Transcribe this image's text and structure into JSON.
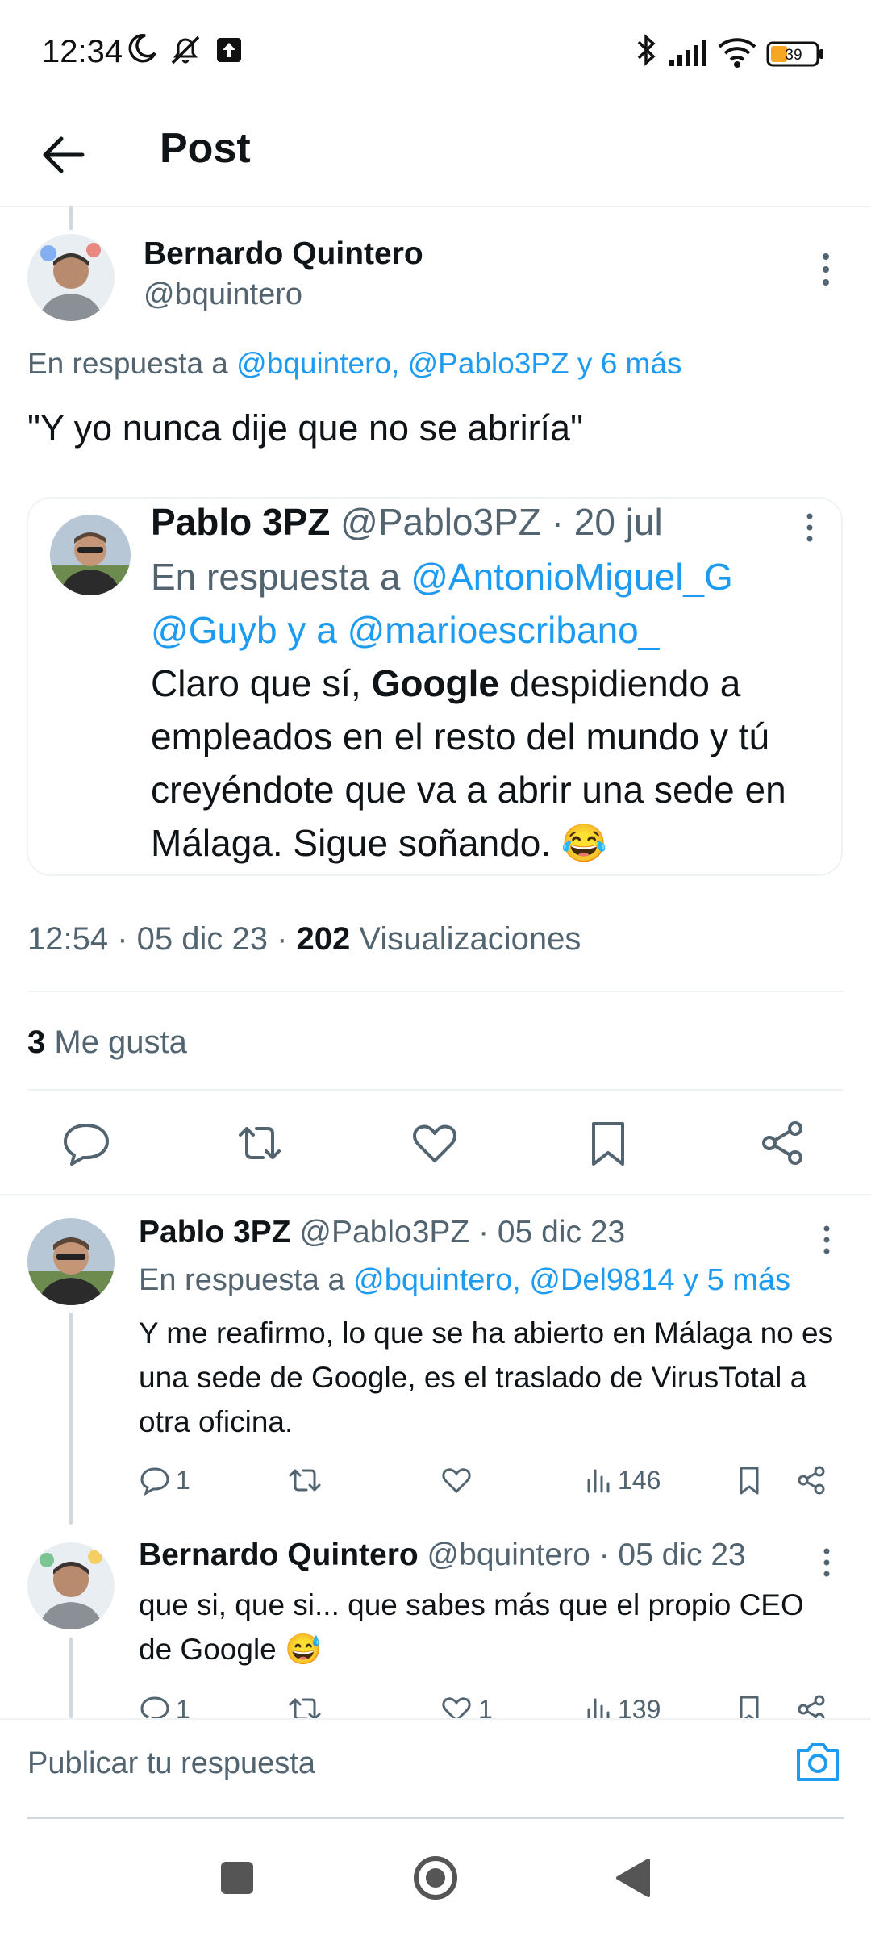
{
  "status_bar": {
    "time": "12:34",
    "battery": "39"
  },
  "header": {
    "title": "Post"
  },
  "main_tweet": {
    "author_name": "Bernardo Quintero",
    "author_handle": "@bquintero",
    "reply_prefix": "En respuesta a",
    "reply_targets": "@bquintero, @Pablo3PZ y 6 más",
    "text": "\"Y yo nunca dije que no se abriría\"",
    "quoted": {
      "author_name": "Pablo 3PZ",
      "author_handle": "@Pablo3PZ",
      "date": "· 20 jul",
      "reply_prefix": "En respuesta a",
      "reply_target_1": "@AntonioMiguel_G",
      "reply_target_2": "@Guyb y a @marioescribano_",
      "text_bold": "Google",
      "text_pre": "Claro que sí,",
      "text_post": "despidiendo a empleados en el resto del mundo y tú creyéndote que va a abrir una sede en Málaga. Sigue soñando. 😂"
    },
    "timestamp": "12:54 · 05 dic 23 ·",
    "views_count": "202",
    "views_label": "Visualizaciones",
    "likes_count": "3",
    "likes_label": "Me gusta"
  },
  "replies": [
    {
      "author_name": "Pablo 3PZ",
      "author_handle": "@Pablo3PZ",
      "date": "· 05 dic 23",
      "reply_prefix": "En respuesta a",
      "reply_targets": "@bquintero, @Del9814 y 5 más",
      "text": "Y me reafirmo, lo que se ha abierto en Málaga no es una sede de Google, es el traslado de VirusTotal a otra oficina.",
      "reply_count": "1",
      "like_count": "",
      "views": "146"
    },
    {
      "author_name": "Bernardo Quintero",
      "author_handle": "@bquintero",
      "date": "· 05 dic 23",
      "text": "que si, que si... que sabes más que el propio CEO de Google 😅",
      "reply_count": "1",
      "like_count": "1",
      "views": "139"
    }
  ],
  "compose": {
    "placeholder": "Publicar tu respuesta"
  },
  "colors": {
    "accent": "#1d9bf0",
    "text": "#0f1419",
    "secondary": "#536471",
    "divider": "#eff3f4"
  }
}
